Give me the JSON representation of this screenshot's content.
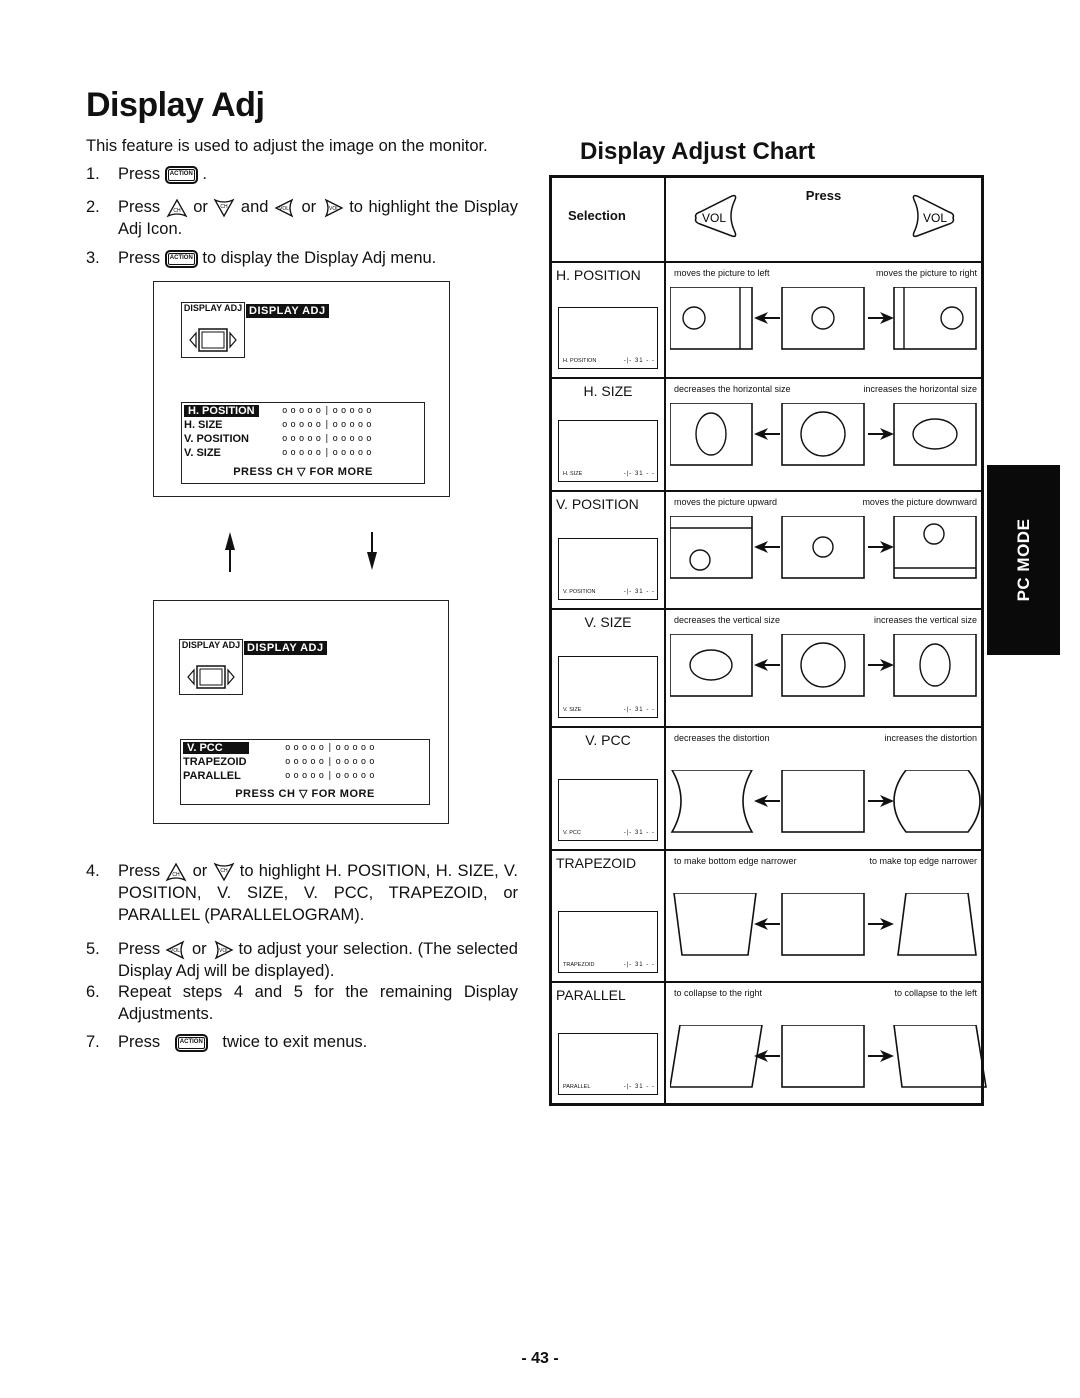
{
  "page": {
    "title": "Display Adj",
    "intro": "This feature is used to adjust the image on the monitor.",
    "page_number": "- 43 -",
    "side_tab": "PC MODE"
  },
  "icons": {
    "action_button": "ACTION",
    "ch_up": "CH",
    "ch_down": "CH",
    "vol_left": "VOL",
    "vol_right": "VOL"
  },
  "steps": [
    {
      "num": "1.",
      "before": "Press",
      "after": "."
    },
    {
      "num": "2.",
      "before": "Press",
      "mid1": "or",
      "mid2": "and",
      "mid3": "or",
      "after": "to highlight the Display Adj Icon."
    },
    {
      "num": "3.",
      "before": "Press",
      "after": "to display the Display Adj menu."
    },
    {
      "num": "4.",
      "before": "Press",
      "mid1": "or",
      "after": "to highlight H. POSITION, H. SIZE, V. POSITION, V. SIZE, V. PCC, TRAPEZOID, or PARALLEL (PARALLELOGRAM)."
    },
    {
      "num": "5.",
      "before": "Press",
      "mid1": "or",
      "after": "to adjust your selection. (The selected Display Adj will be displayed)."
    },
    {
      "num": "6.",
      "text": "Repeat steps 4 and 5 for the remaining Display Adjustments."
    },
    {
      "num": "7.",
      "before": "Press",
      "after": "twice to exit menus."
    }
  ],
  "osd_screens": [
    {
      "icon_label": "DISPLAY ADJ",
      "header": "DISPLAY ADJ",
      "items": [
        {
          "label": "H. POSITION",
          "selected": true,
          "value": 0.5
        },
        {
          "label": "H. SIZE",
          "selected": false,
          "value": 0.5
        },
        {
          "label": "V. POSITION",
          "selected": false,
          "value": 0.5
        },
        {
          "label": "V. SIZE",
          "selected": false,
          "value": 0.5
        }
      ],
      "footer": "PRESS CH ▽ FOR MORE"
    },
    {
      "icon_label": "DISPLAY ADJ",
      "header": "DISPLAY ADJ",
      "items": [
        {
          "label": "V. PCC",
          "selected": true,
          "value": 0.5
        },
        {
          "label": "TRAPEZOID",
          "selected": false,
          "value": 0.5
        },
        {
          "label": "PARALLEL",
          "selected": false,
          "value": 0.5
        }
      ],
      "footer": "PRESS CH ▽ FOR MORE"
    }
  ],
  "chart": {
    "title": "Display Adjust Chart",
    "header_selection": "Selection",
    "header_press": "Press",
    "rows": [
      {
        "name": "H. POSITION",
        "mini_label": "H. POSITION",
        "mini_value": "31",
        "left": "moves the picture to left",
        "right": "moves the picture to right",
        "shape": "hpos"
      },
      {
        "name": "H. SIZE",
        "mini_label": "H. SIZE",
        "mini_value": "31",
        "left": "decreases the horizontal size",
        "right": "increases the horizontal size",
        "shape": "hsize"
      },
      {
        "name": "V. POSITION",
        "mini_label": "V. POSITION",
        "mini_value": "31",
        "left": "moves the picture upward",
        "right": "moves the picture downward",
        "shape": "vpos"
      },
      {
        "name": "V. SIZE",
        "mini_label": "V. SIZE",
        "mini_value": "31",
        "left": "decreases the vertical size",
        "right": "increases the vertical size",
        "shape": "vsize"
      },
      {
        "name": "V. PCC",
        "mini_label": "V. PCC",
        "mini_value": "31",
        "left": "decreases the distortion",
        "right": "increases the distortion",
        "shape": "pcc"
      },
      {
        "name": "TRAPEZOID",
        "mini_label": "TRAPEZOID",
        "mini_value": "31",
        "left": "to make bottom edge narrower",
        "right": "to make top edge narrower",
        "shape": "trap"
      },
      {
        "name": "PARALLEL",
        "mini_label": "PARALLEL",
        "mini_value": "31",
        "left": "to collapse to the right",
        "right": "to collapse to the left",
        "shape": "para"
      }
    ]
  }
}
